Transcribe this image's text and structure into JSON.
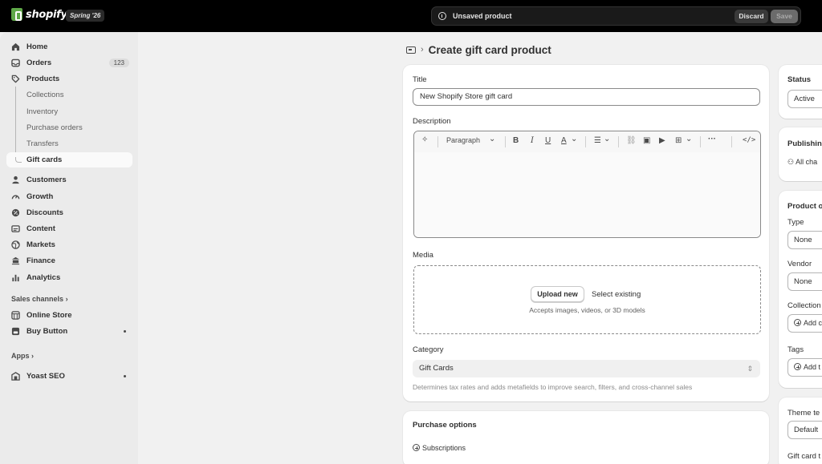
{
  "topbar": {
    "logo_text": "shopify",
    "version": "Spring '26",
    "unsaved_text": "Unsaved product",
    "discard_label": "Discard",
    "save_label": "Save"
  },
  "sidebar": {
    "home": "Home",
    "orders": "Orders",
    "orders_count": "123",
    "products": "Products",
    "collections": "Collections",
    "inventory": "Inventory",
    "purchase_orders": "Purchase orders",
    "transfers": "Transfers",
    "gift_cards": "Gift cards",
    "customers": "Customers",
    "growth": "Growth",
    "discounts": "Discounts",
    "content": "Content",
    "markets": "Markets",
    "finance": "Finance",
    "analytics": "Analytics",
    "sales_channels": "Sales channels",
    "online_store": "Online Store",
    "buy_button": "Buy Button",
    "apps": "Apps",
    "yoast": "Yoast SEO"
  },
  "page": {
    "title": "Create gift card product"
  },
  "form": {
    "title_label": "Title",
    "title_value": "New Shopify Store gift card",
    "description_label": "Description",
    "paragraph_label": "Paragraph",
    "media_label": "Media",
    "upload_label": "Upload new",
    "select_existing": "Select existing",
    "accepts": "Accepts images, videos, or 3D models",
    "category_label": "Category",
    "category_value": "Gift Cards",
    "category_help": "Determines tax rates and adds metafields to improve search, filters, and cross-channel sales"
  },
  "purchase": {
    "title": "Purchase options",
    "subscriptions": "Subscriptions"
  },
  "right": {
    "status_title": "Status",
    "status_value": "Active",
    "publishing_title": "Publishing",
    "publishing_value": "All cha",
    "product_org_title": "Product o",
    "type_label": "Type",
    "type_value": "None",
    "vendor_label": "Vendor",
    "vendor_value": "None",
    "collections_label": "Collection",
    "collections_value": "Add c",
    "tags_label": "Tags",
    "tags_value": "Add t",
    "theme_title": "Theme te",
    "theme_value": "Default",
    "giftcard_t": "Gift card t"
  }
}
